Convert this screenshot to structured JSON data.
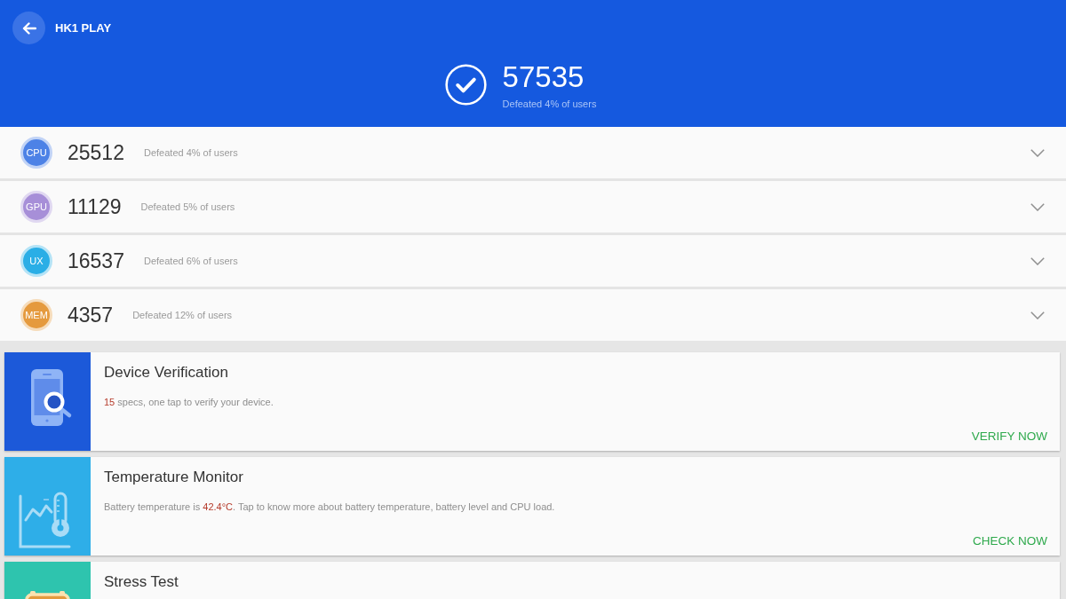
{
  "header": {
    "title": "HK1 PLAY",
    "total_score": "57535",
    "caption": "Defeated 4% of users"
  },
  "scores": [
    {
      "label": "CPU",
      "color": "#4d82e6",
      "score": "25512",
      "caption": "Defeated 4% of users",
      "expanded": false
    },
    {
      "label": "GPU",
      "color": "#a78fd8",
      "score": "11129",
      "caption": "Defeated 5% of users",
      "expanded": false
    },
    {
      "label": "UX",
      "color": "#2aaee6",
      "score": "16537",
      "caption": "Defeated 6% of users",
      "expanded": false
    },
    {
      "label": "MEM",
      "color": "#e59a3e",
      "score": "4357",
      "caption": "Defeated 12% of users",
      "expanded": false
    }
  ],
  "cards": [
    {
      "kind": "verification",
      "color": "#1c59d9",
      "title": "Device Verification",
      "description": "**15** specs, one tap to verify your device.",
      "action": "VERIFY NOW"
    },
    {
      "kind": "temperature",
      "color": "#2eaee8",
      "title": "Temperature Monitor",
      "description": "Battery temperature is **42.4°C**. Tap to know more about battery temperature, battery level and CPU load.",
      "action": "CHECK NOW"
    },
    {
      "kind": "stress",
      "color": "#2ec4ae",
      "title": "Stress Test"
    }
  ]
}
